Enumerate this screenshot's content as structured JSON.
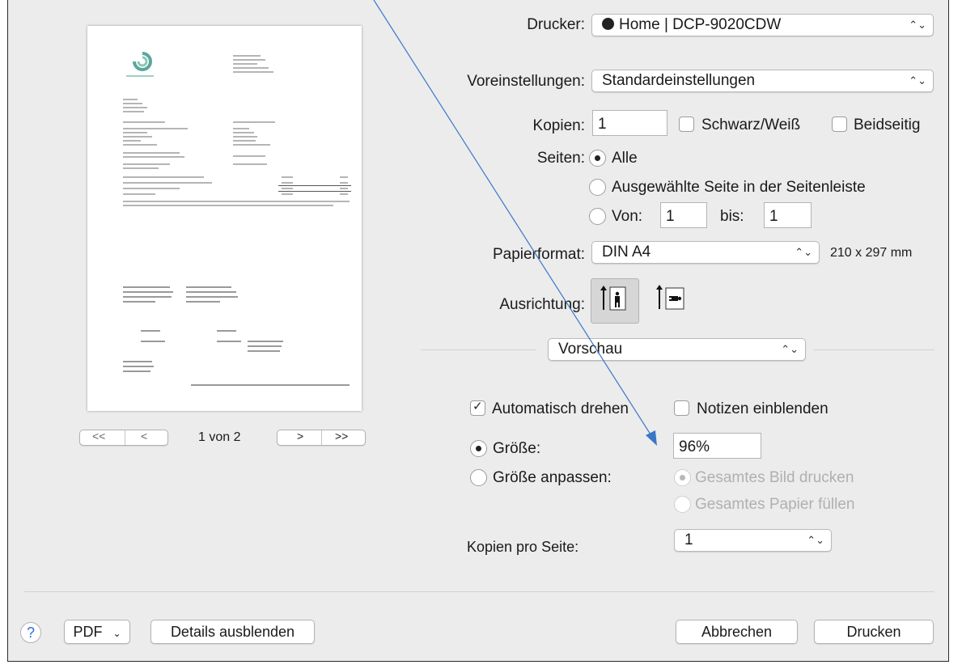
{
  "printer": {
    "label": "Drucker:",
    "value": "Home | DCP-9020CDW"
  },
  "presets": {
    "label": "Voreinstellungen:",
    "value": "Standardeinstellungen"
  },
  "copies": {
    "label": "Kopien:",
    "value": "1",
    "bw_label": "Schwarz/Weiß",
    "bw_checked": false,
    "duplex_label": "Beidseitig",
    "duplex_checked": false
  },
  "pages": {
    "label": "Seiten:",
    "all": "Alle",
    "selected": "Ausgewählte Seite in der Seitenleiste",
    "from_label": "Von:",
    "from_value": "1",
    "to_label": "bis:",
    "to_value": "1"
  },
  "paper": {
    "label": "Papierformat:",
    "value": "DIN A4",
    "size": "210 x 297 mm"
  },
  "orientation": {
    "label": "Ausrichtung:"
  },
  "section": {
    "value": "Vorschau"
  },
  "preview_options": {
    "auto_rotate": "Automatisch drehen",
    "auto_rotate_checked": true,
    "show_notes": "Notizen einblenden",
    "show_notes_checked": false,
    "size_label": "Größe:",
    "size_value": "96%",
    "fit_label": "Größe anpassen:",
    "fit_print_all": "Gesamtes Bild drucken",
    "fit_fill_paper": "Gesamtes Papier füllen"
  },
  "pages_per_sheet": {
    "label": "Kopien pro Seite:",
    "value": "1"
  },
  "pager": {
    "first": "<<",
    "prev": "<",
    "text": "1 von 2",
    "next": ">",
    "last": ">>"
  },
  "footer": {
    "help": "?",
    "pdf": "PDF",
    "details": "Details ausblenden",
    "cancel": "Abbrechen",
    "print": "Drucken"
  }
}
